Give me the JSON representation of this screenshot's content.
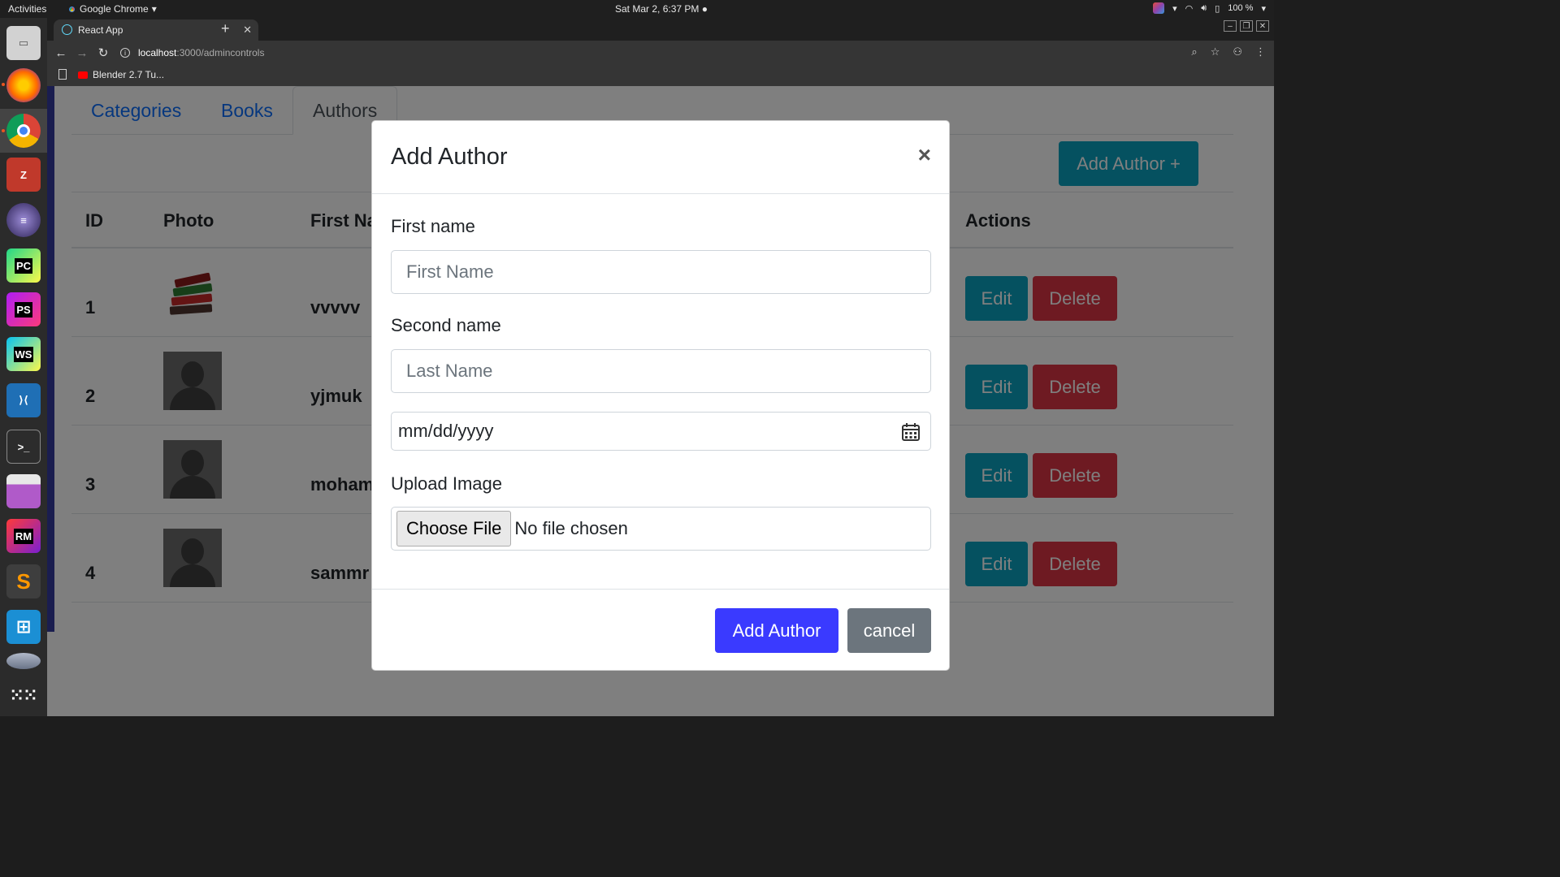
{
  "desktop": {
    "activities": "Activities",
    "app_menu": "Google Chrome",
    "clock": "Sat Mar  2,  6:37 PM",
    "battery": "100 %"
  },
  "browser": {
    "tab_title": "React App",
    "url_host": "localhost",
    "url_path": ":3000/admincontrols",
    "bookmark": "Blender 2.7 Tu..."
  },
  "page": {
    "tabs": [
      {
        "label": "Categories"
      },
      {
        "label": "Books"
      },
      {
        "label": "Authors"
      }
    ],
    "add_author_button": "Add Author +",
    "table": {
      "headers": {
        "id": "ID",
        "photo": "Photo",
        "first_name": "First Na",
        "actions": "Actions"
      },
      "rows": [
        {
          "id": "1",
          "first_name": "vvvvv",
          "photo": "books-image"
        },
        {
          "id": "2",
          "first_name": "yjmuk",
          "photo": "avatar-placeholder"
        },
        {
          "id": "3",
          "first_name": "moham",
          "photo": "avatar-placeholder"
        },
        {
          "id": "4",
          "first_name": "sammr",
          "photo": "avatar-placeholder"
        }
      ],
      "edit_label": "Edit",
      "delete_label": "Delete"
    }
  },
  "modal": {
    "title": "Add Author",
    "close_glyph": "×",
    "first_name_label": "First name",
    "first_name_placeholder": "First Name",
    "second_name_label": "Second name",
    "second_name_placeholder": "Last Name",
    "date_placeholder": "mm/dd/yyyy",
    "upload_label": "Upload Image",
    "choose_file": "Choose File",
    "no_file": "No file chosen",
    "submit": "Add Author",
    "cancel": "cancel"
  },
  "colors": {
    "primary": "#3a3aff",
    "info": "#0aa2c0",
    "danger": "#dc3545",
    "secondary": "#6c757d"
  }
}
